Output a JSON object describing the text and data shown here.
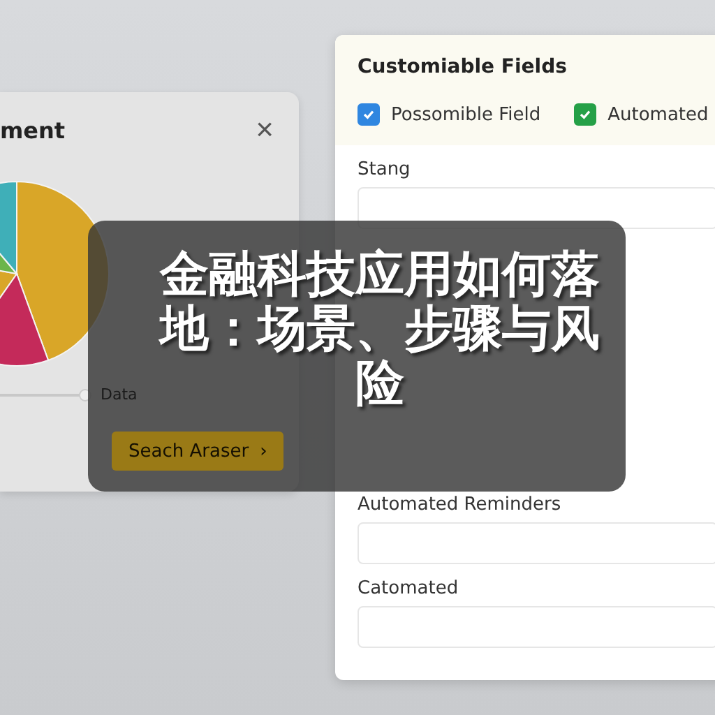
{
  "chart_panel": {
    "title": "ment",
    "close": "×",
    "legend": "Data",
    "button": {
      "label": "Seach Araser",
      "caret": "›"
    }
  },
  "fields_panel": {
    "title": "Customiable Fields",
    "checkboxes": [
      {
        "label": "Possomible Field",
        "checked": true,
        "color": "#2f86e0"
      },
      {
        "label": "Automated",
        "checked": true,
        "color": "#25a047"
      }
    ],
    "fields": [
      {
        "label": "Stang"
      },
      {
        "label": "Automated Reminders"
      },
      {
        "label": "Catomated"
      }
    ]
  },
  "overlay": {
    "headline": "金融科技应用如何落地：场景、步骤与风险"
  }
}
